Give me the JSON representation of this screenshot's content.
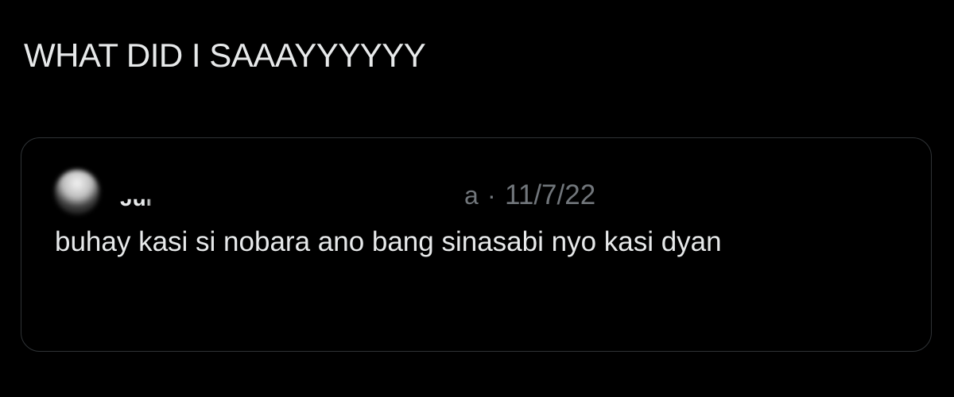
{
  "tweet": {
    "text": "WHAT DID I SAAAYYYYYY"
  },
  "quote": {
    "author_name": "Jul",
    "handle_tail": "a",
    "separator": "·",
    "date": "11/7/22",
    "text": "buhay kasi si nobara ano bang sinasabi nyo kasi dyan"
  },
  "colors": {
    "background": "#000000",
    "primary_text": "#e7e9ea",
    "secondary_text": "#71767b",
    "card_border": "#2f3336"
  }
}
